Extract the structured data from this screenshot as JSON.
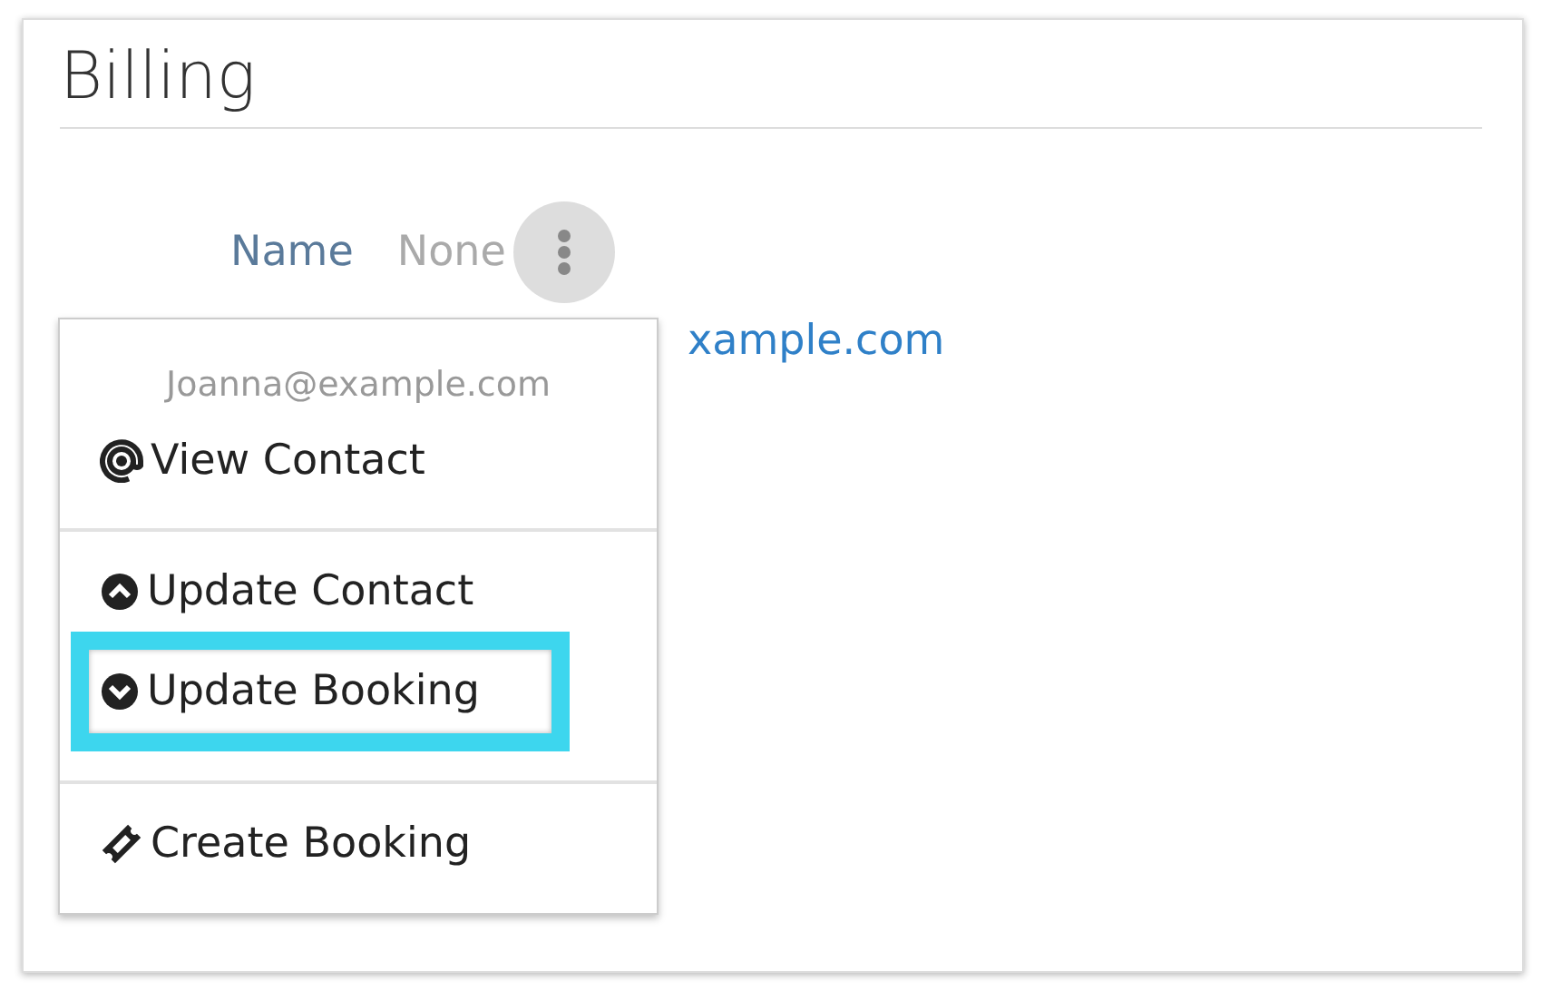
{
  "section": {
    "title": "Billing"
  },
  "field": {
    "label": "Name",
    "value": "None"
  },
  "background_link": "xample.com",
  "menu": {
    "open": true,
    "header": "Joanna@example.com",
    "groups": [
      [
        {
          "label": "View Contact",
          "highlighted": false
        }
      ],
      [
        {
          "label": "Update Contact",
          "highlighted": false
        },
        {
          "label": "Update Booking",
          "highlighted": true
        }
      ],
      [
        {
          "label": "Create Booking",
          "highlighted": false
        }
      ]
    ]
  }
}
